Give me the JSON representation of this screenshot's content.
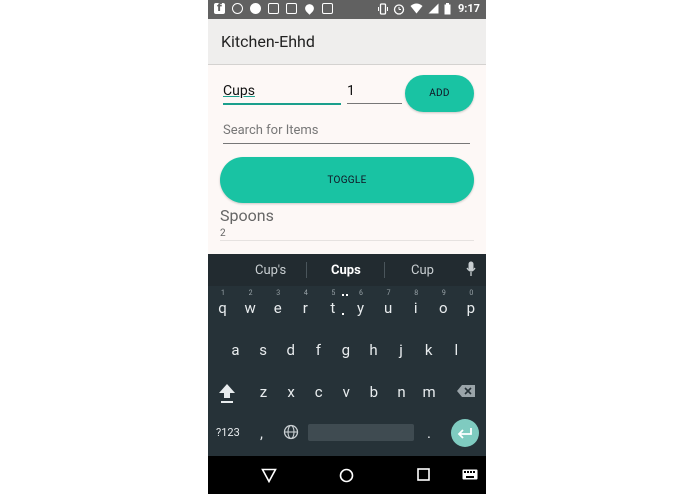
{
  "status_bar": {
    "time": "9:17"
  },
  "app": {
    "title": "Kitchen-Ehhd"
  },
  "form": {
    "item_value": "Cups",
    "quantity_value": "1",
    "add_label": "ADD",
    "search_placeholder": "Search for Items",
    "toggle_label": "TOGGLE"
  },
  "items": [
    {
      "name": "Spoons",
      "count": "2"
    }
  ],
  "keyboard": {
    "suggestions": [
      "Cup's",
      "Cups",
      "Cup"
    ],
    "row1": [
      "q",
      "w",
      "e",
      "r",
      "t",
      "y",
      "u",
      "i",
      "o",
      "p"
    ],
    "row1_hints": [
      "1",
      "2",
      "3",
      "4",
      "5",
      "6",
      "7",
      "8",
      "9",
      "0"
    ],
    "row2": [
      "a",
      "s",
      "d",
      "f",
      "g",
      "h",
      "j",
      "k",
      "l"
    ],
    "row3": [
      "z",
      "x",
      "c",
      "v",
      "b",
      "n",
      "m"
    ],
    "symbols_label": "?123",
    "comma": ",",
    "period": "."
  }
}
